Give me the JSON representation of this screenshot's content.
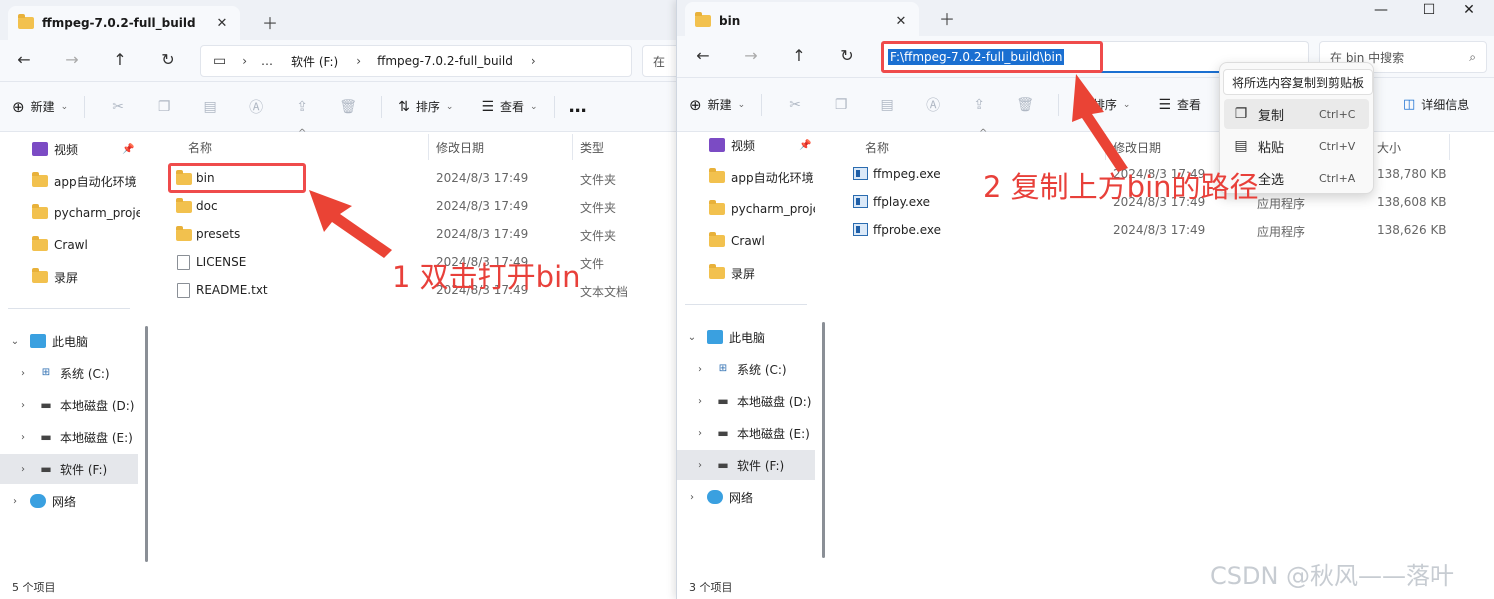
{
  "left": {
    "tab_title": "ffmpeg-7.0.2-full_build",
    "breadcrumb": [
      "软件 (F:)",
      "ffmpeg-7.0.2-full_build"
    ],
    "breadcrumb_more": "…",
    "search_placeholder": "在",
    "toolbar": {
      "new": "新建",
      "sort": "排序",
      "view": "查看",
      "more": "…"
    },
    "sidebar": {
      "quick": [
        {
          "label": "视频",
          "icon": "video-folder-icon",
          "pinned": true
        },
        {
          "label": "app自动化环境",
          "icon": "folder-icon"
        },
        {
          "label": "pycharm_proje",
          "icon": "folder-icon"
        },
        {
          "label": "Crawl",
          "icon": "folder-icon"
        },
        {
          "label": "录屏",
          "icon": "folder-icon"
        }
      ],
      "this_pc": "此电脑",
      "drives": [
        "系统 (C:)",
        "本地磁盘 (D:)",
        "本地磁盘 (E:)",
        "软件 (F:)"
      ],
      "network": "网络"
    },
    "columns": [
      "名称",
      "修改日期",
      "类型"
    ],
    "files": [
      {
        "name": "bin",
        "date": "2024/8/3 17:49",
        "type": "文件夹",
        "kind": "folder"
      },
      {
        "name": "doc",
        "date": "2024/8/3 17:49",
        "type": "文件夹",
        "kind": "folder"
      },
      {
        "name": "presets",
        "date": "2024/8/3 17:49",
        "type": "文件夹",
        "kind": "folder"
      },
      {
        "name": "LICENSE",
        "date": "2024/8/3 17:49",
        "type": "文件",
        "kind": "file"
      },
      {
        "name": "README.txt",
        "date": "2024/8/3 17:49",
        "type": "文本文档",
        "kind": "file"
      }
    ],
    "status": "5 个项目"
  },
  "right": {
    "tab_title": "bin",
    "address_path": "F:\\ffmpeg-7.0.2-full_build\\bin",
    "search_placeholder": "在 bin 中搜索",
    "toolbar": {
      "new": "新建",
      "sort": "排序",
      "view": "查看",
      "details": "详细信息"
    },
    "sidebar": {
      "quick": [
        {
          "label": "视频",
          "icon": "video-folder-icon",
          "pinned": true
        },
        {
          "label": "app自动化环境",
          "icon": "folder-icon"
        },
        {
          "label": "pycharm_proje",
          "icon": "folder-icon"
        },
        {
          "label": "Crawl",
          "icon": "folder-icon"
        },
        {
          "label": "录屏",
          "icon": "folder-icon"
        }
      ],
      "this_pc": "此电脑",
      "drives": [
        "系统 (C:)",
        "本地磁盘 (D:)",
        "本地磁盘 (E:)",
        "软件 (F:)"
      ],
      "network": "网络"
    },
    "columns": [
      "名称",
      "修改日期",
      "大小"
    ],
    "files": [
      {
        "name": "ffmpeg.exe",
        "date": "2024/8/3 17:49",
        "type": "应用程序",
        "size": "138,780 KB"
      },
      {
        "name": "ffplay.exe",
        "date": "2024/8/3 17:49",
        "type": "应用程序",
        "size": "138,608 KB"
      },
      {
        "name": "ffprobe.exe",
        "date": "2024/8/3 17:49",
        "type": "应用程序",
        "size": "138,626 KB"
      }
    ],
    "status": "3 个项目"
  },
  "context_menu": {
    "tooltip": "将所选内容复制到剪贴板",
    "items": [
      {
        "label": "复制",
        "shortcut": "Ctrl+C",
        "icon": "copy-icon"
      },
      {
        "label": "粘贴",
        "shortcut": "Ctrl+V",
        "icon": "paste-icon"
      },
      {
        "label": "全选",
        "shortcut": "Ctrl+A",
        "icon": ""
      }
    ]
  },
  "annotations": {
    "step1": "1 双击打开bin",
    "step2": "2 复制上方bin的路径",
    "color": "#e8403a"
  },
  "watermark": "CSDN @秋风——落叶"
}
